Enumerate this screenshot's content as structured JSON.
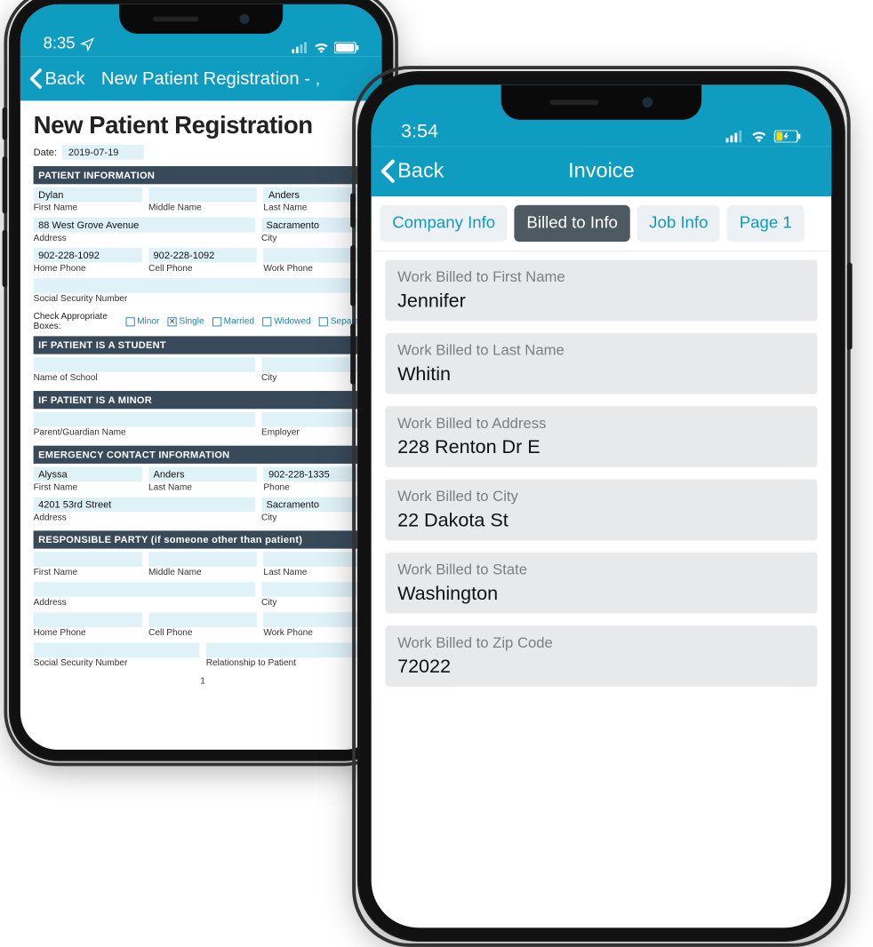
{
  "phoneA": {
    "status_time": "8:35",
    "back_label": "Back",
    "nav_title": "New Patient Registration - ,",
    "page_title": "New Patient Registration",
    "date_label": "Date:",
    "date_value": "2019-07-19",
    "sec_patient": "PATIENT INFORMATION",
    "first_name": "Dylan",
    "first_name_lab": "First Name",
    "middle_name": "",
    "middle_name_lab": "Middle Name",
    "last_name": "Anders",
    "last_name_lab": "Last Name",
    "address": "88 West Grove Avenue",
    "address_lab": "Address",
    "city": "Sacramento",
    "city_lab": "City",
    "home_phone": "902-228-1092",
    "home_phone_lab": "Home Phone",
    "cell_phone": "902-228-1092",
    "cell_phone_lab": "Cell Phone",
    "work_phone": "",
    "work_phone_lab": "Work Phone",
    "ssn": "",
    "ssn_lab": "Social Security Number",
    "checks_lab": "Check Appropriate Boxes:",
    "chk_minor": "Minor",
    "chk_single": "Single",
    "chk_married": "Married",
    "chk_widowed": "Widowed",
    "chk_separated": "Separated",
    "sec_student": "IF PATIENT IS A STUDENT",
    "school": "",
    "school_lab": "Name of School",
    "school_city": "",
    "school_city_lab": "City",
    "sec_minor": "IF PATIENT IS A MINOR",
    "guardian": "",
    "guardian_lab": "Parent/Guardian Name",
    "employer": "",
    "employer_lab": "Employer",
    "sec_emergency": "EMERGENCY CONTACT INFORMATION",
    "ec_first": "Alyssa",
    "ec_first_lab": "First Name",
    "ec_last": "Anders",
    "ec_last_lab": "Last Name",
    "ec_phone": "902-228-1335",
    "ec_phone_lab": "Phone",
    "ec_addr": "4201 53rd Street",
    "ec_addr_lab": "Address",
    "ec_city": "Sacramento",
    "ec_city_lab": "City",
    "sec_resp": "RESPONSIBLE PARTY (if someone other than patient)",
    "rp_first": "",
    "rp_first_lab": "First Name",
    "rp_middle": "",
    "rp_middle_lab": "Middle Name",
    "rp_last": "",
    "rp_last_lab": "Last Name",
    "rp_addr": "",
    "rp_addr_lab": "Address",
    "rp_city": "",
    "rp_city_lab": "City",
    "rp_home": "",
    "rp_home_lab": "Home Phone",
    "rp_cell": "",
    "rp_cell_lab": "Cell Phone",
    "rp_work": "",
    "rp_work_lab": "Work Phone",
    "rp_ssn": "",
    "rp_ssn_lab": "Social Security Number",
    "rp_rel": "",
    "rp_rel_lab": "Relationship to Patient",
    "page_no": "1"
  },
  "phoneB": {
    "status_time": "3:54",
    "back_label": "Back",
    "nav_title": "Invoice",
    "tabs": {
      "company": "Company Info",
      "billed": "Billed to Info",
      "job": "Job Info",
      "page1": "Page 1"
    },
    "fields": [
      {
        "label": "Work Billed to First Name",
        "value": "Jennifer"
      },
      {
        "label": "Work Billed to Last Name",
        "value": "Whitin"
      },
      {
        "label": "Work Billed to Address",
        "value": "228 Renton Dr E"
      },
      {
        "label": "Work Billed to City",
        "value": "22 Dakota St"
      },
      {
        "label": "Work Billed to State",
        "value": "Washington"
      },
      {
        "label": "Work Billed to Zip Code",
        "value": "72022"
      }
    ]
  }
}
